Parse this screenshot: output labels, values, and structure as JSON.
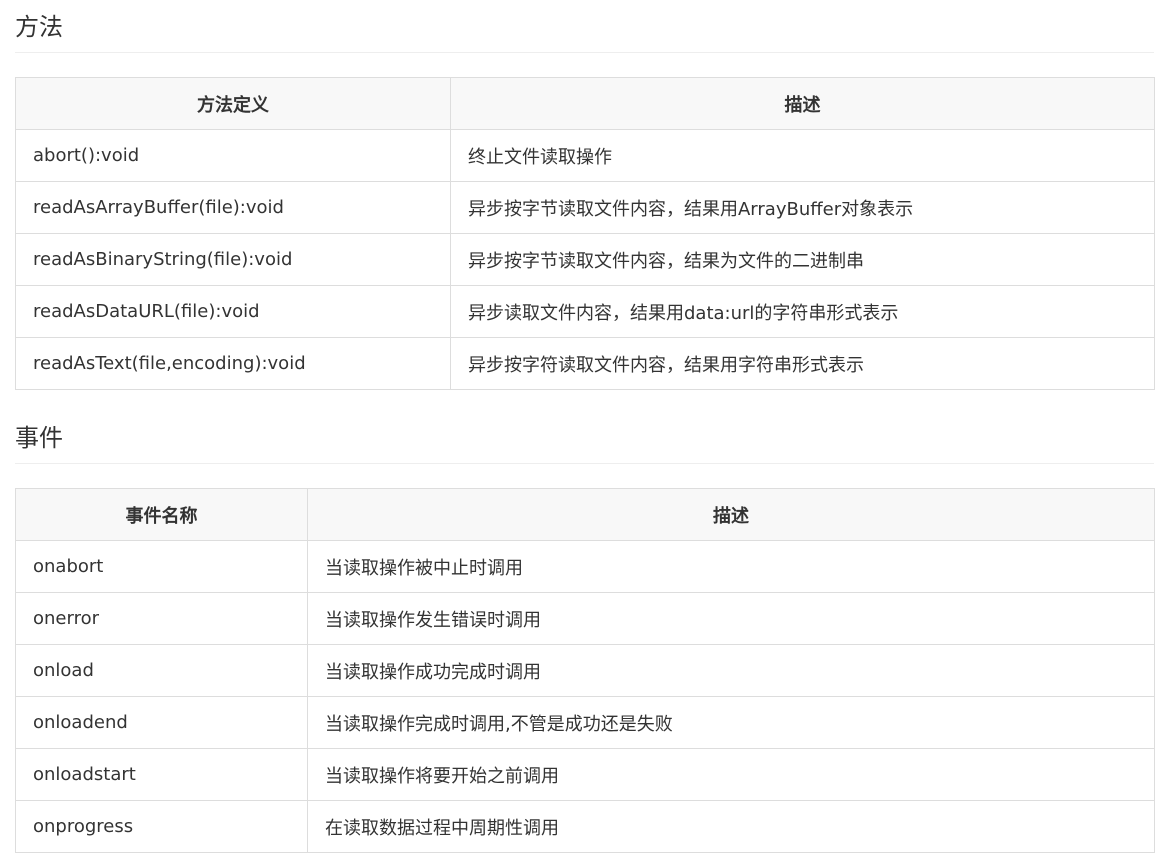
{
  "methods": {
    "title": "方法",
    "headers": [
      "方法定义",
      "描述"
    ],
    "rows": [
      [
        "abort():void",
        "终止文件读取操作"
      ],
      [
        "readAsArrayBuffer(file):void",
        "异步按字节读取文件内容，结果用ArrayBuffer对象表示"
      ],
      [
        "readAsBinaryString(file):void",
        "异步按字节读取文件内容，结果为文件的二进制串"
      ],
      [
        "readAsDataURL(file):void",
        "异步读取文件内容，结果用data:url的字符串形式表示"
      ],
      [
        "readAsText(file,encoding):void",
        "异步按字符读取文件内容，结果用字符串形式表示"
      ]
    ]
  },
  "events": {
    "title": "事件",
    "headers": [
      "事件名称",
      "描述"
    ],
    "rows": [
      [
        "onabort",
        "当读取操作被中止时调用"
      ],
      [
        "onerror",
        "当读取操作发生错误时调用"
      ],
      [
        "onload",
        "当读取操作成功完成时调用"
      ],
      [
        "onloadend",
        "当读取操作完成时调用,不管是成功还是失败"
      ],
      [
        "onloadstart",
        "当读取操作将要开始之前调用"
      ],
      [
        "onprogress",
        "在读取数据过程中周期性调用"
      ]
    ]
  }
}
